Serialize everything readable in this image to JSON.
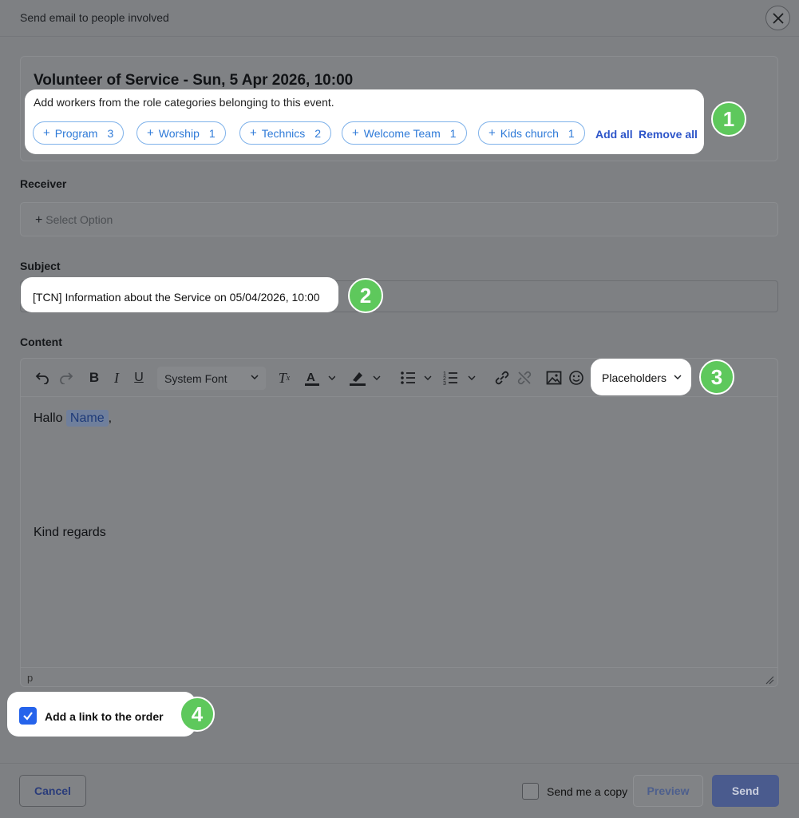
{
  "dialog": {
    "title": "Send email to people involved"
  },
  "event": {
    "title": "Volunteer of Service - Sun, 5 Apr 2026, 10:00",
    "roles_description": "Add workers from the role categories belonging to this event.",
    "roles": [
      {
        "label": "Program",
        "count": "3"
      },
      {
        "label": "Worship",
        "count": "1"
      },
      {
        "label": "Technics",
        "count": "2"
      },
      {
        "label": "Welcome Team",
        "count": "1"
      },
      {
        "label": "Kids church",
        "count": "1"
      }
    ],
    "add_all": "Add all",
    "remove_all": "Remove all"
  },
  "receiver": {
    "label": "Receiver",
    "placeholder": "Select Option"
  },
  "subject": {
    "label": "Subject",
    "value": "[TCN] Information about the Service on 05/04/2026, 10:00"
  },
  "content": {
    "label": "Content",
    "font": "System Font",
    "placeholders_label": "Placeholders",
    "greeting": "Hallo",
    "name_placeholder": "Name",
    "greeting_suffix": ",",
    "closing": "Kind regards",
    "status_tag": "p"
  },
  "options": {
    "add_link_label": "Add a link to the order",
    "add_link_checked": true
  },
  "footer": {
    "cancel": "Cancel",
    "send_copy": "Send me a copy",
    "preview": "Preview",
    "send": "Send"
  },
  "badges": [
    "1",
    "2",
    "3",
    "4"
  ],
  "colors": {
    "accent": "#2563eb",
    "badge": "#5ec85c",
    "chip": "#2e7ad8"
  }
}
